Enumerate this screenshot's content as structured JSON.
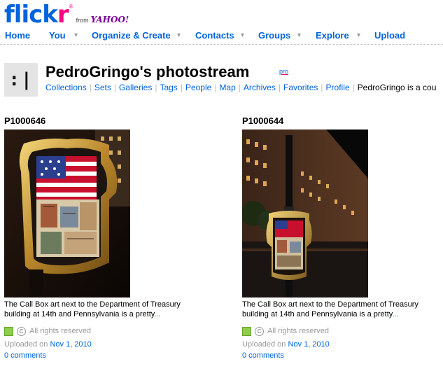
{
  "logo": {
    "text_part1": "flick",
    "text_part2": "r",
    "from": "from",
    "yahoo": "YAHOO!"
  },
  "nav": {
    "items": [
      {
        "label": "Home"
      },
      {
        "label": "You"
      },
      {
        "label": "Organize & Create"
      },
      {
        "label": "Contacts"
      },
      {
        "label": "Groups"
      },
      {
        "label": "Explore"
      },
      {
        "label": "Upload"
      }
    ],
    "arrow_glyph": "▾"
  },
  "profile": {
    "avatar_glyph": ":|",
    "title": "PedroGringo's photostream",
    "pro_badge": "pro",
    "links": [
      "Collections",
      "Sets",
      "Galleries",
      "Tags",
      "People",
      "Map",
      "Archives",
      "Favorites",
      "Profile"
    ],
    "description": "PedroGringo is a cou"
  },
  "photos": [
    {
      "title": "P1000646",
      "desc": "The Call Box art next to the Department of Treasury building at 14th and Pennsylvania is a pretty",
      "ellipsis": "...",
      "license": "All rights reserved",
      "uploaded_label": "Uploaded on",
      "uploaded_date": "Nov 1, 2010",
      "comments": "0 comments"
    },
    {
      "title": "P1000644",
      "desc": "The Call Box art next to the Department of Treasury building at 14th and Pennsylvania is a pretty",
      "ellipsis": "...",
      "license": "All rights reserved",
      "uploaded_label": "Uploaded on",
      "uploaded_date": "Nov 1, 2010",
      "comments": "0 comments"
    }
  ],
  "colors": {
    "flickr_blue": "#0063dc",
    "flickr_pink": "#ff0084",
    "license_green": "#8fcd4a"
  },
  "icons": {
    "license": "license-green-square-icon",
    "copyright": "copyright-icon"
  }
}
